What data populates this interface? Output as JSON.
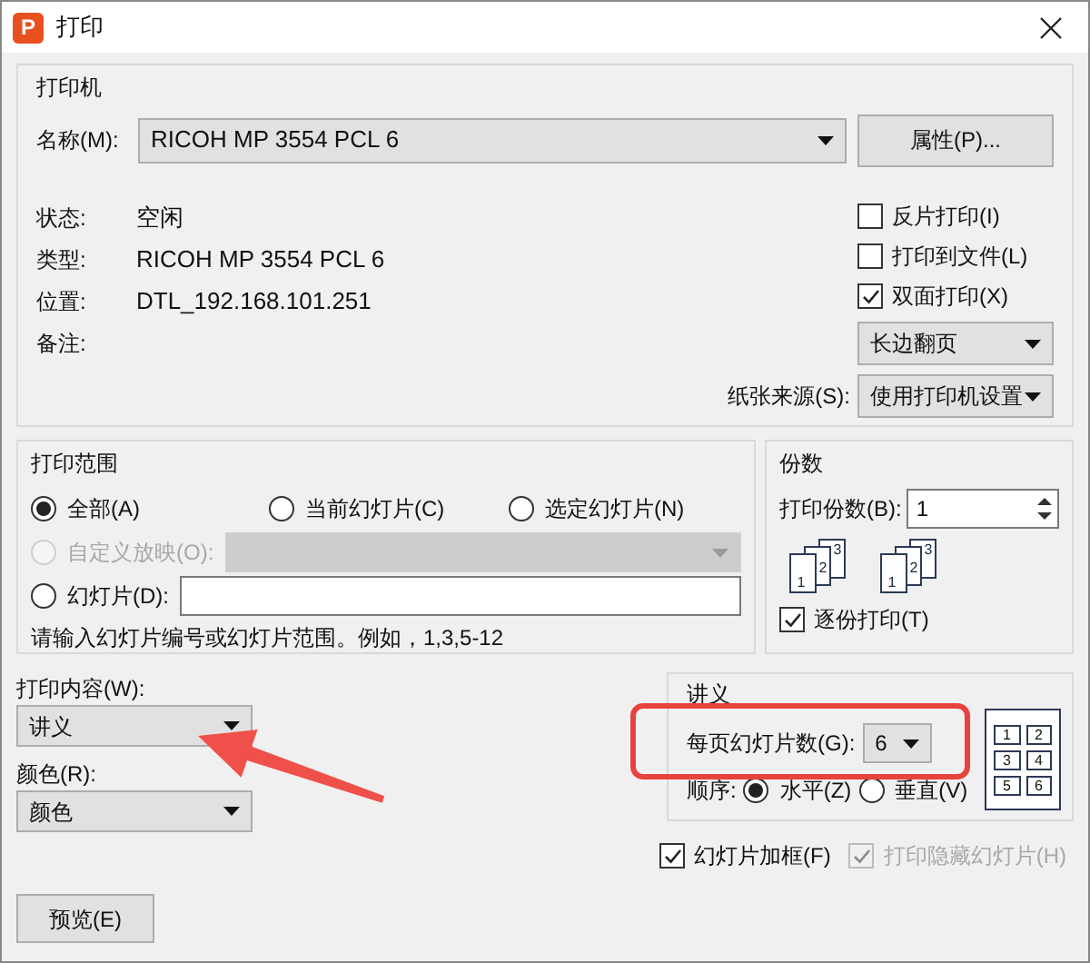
{
  "window": {
    "app_icon": "P",
    "title": "打印"
  },
  "printer": {
    "title": "打印机",
    "name_label": "名称(M):",
    "name_value": "RICOH MP 3554 PCL 6",
    "properties_button": "属性(P)...",
    "info": [
      {
        "label": "状态:",
        "value": "空闲"
      },
      {
        "label": "类型:",
        "value": "RICOH MP 3554 PCL 6"
      },
      {
        "label": "位置:",
        "value": "DTL_192.168.101.251"
      },
      {
        "label": "备注:"
      }
    ],
    "options": [
      {
        "label": "反片打印(I)",
        "checked": false
      },
      {
        "label": "打印到文件(L)",
        "checked": false
      },
      {
        "label": "双面打印(X)",
        "checked": true
      }
    ],
    "duplex_mode": "长边翻页",
    "paper_source_label": "纸张来源(S):",
    "paper_source": "使用打印机设置"
  },
  "range": {
    "title": "打印范围",
    "choices": [
      {
        "label": "全部(A)",
        "selected": true
      },
      {
        "label": "当前幻灯片(C)",
        "selected": false
      },
      {
        "label": "选定幻灯片(N)",
        "selected": false
      }
    ],
    "custom_show": {
      "label": "自定义放映(O):",
      "selected": false,
      "disabled": true
    },
    "slides": {
      "label": "幻灯片(D):",
      "selected": false
    },
    "hint": "请输入幻灯片编号或幻灯片范围。例如，1,3,5-12"
  },
  "copies": {
    "title": "份数",
    "count_label": "打印份数(B):",
    "count": "1",
    "collate_icons": [
      {
        "pages": [
          "1",
          "2",
          "3"
        ]
      },
      {
        "pages": [
          "1",
          "2",
          "3"
        ]
      }
    ],
    "collate": {
      "label": "逐份打印(T)",
      "checked": true
    }
  },
  "content": {
    "label": "打印内容(W):",
    "value": "讲义"
  },
  "color": {
    "label": "颜色(R):",
    "value": "颜色"
  },
  "handout": {
    "title": "讲义",
    "per_page_label": "每页幻灯片数(G):",
    "per_page": "6",
    "order_label": "顺序:",
    "orders": [
      {
        "label": "水平(Z)",
        "selected": true
      },
      {
        "label": "垂直(V)",
        "selected": false
      }
    ],
    "layout_preview": [
      "1",
      "2",
      "3",
      "4",
      "5",
      "6"
    ]
  },
  "frame": {
    "label": "幻灯片加框(F)",
    "checked": true,
    "disabled": false
  },
  "hidden": {
    "label": "打印隐藏幻灯片(H)",
    "checked": true,
    "disabled": true
  },
  "preview_button": "预览(E)",
  "annotations": {
    "highlight_box": true,
    "arrow": true
  }
}
